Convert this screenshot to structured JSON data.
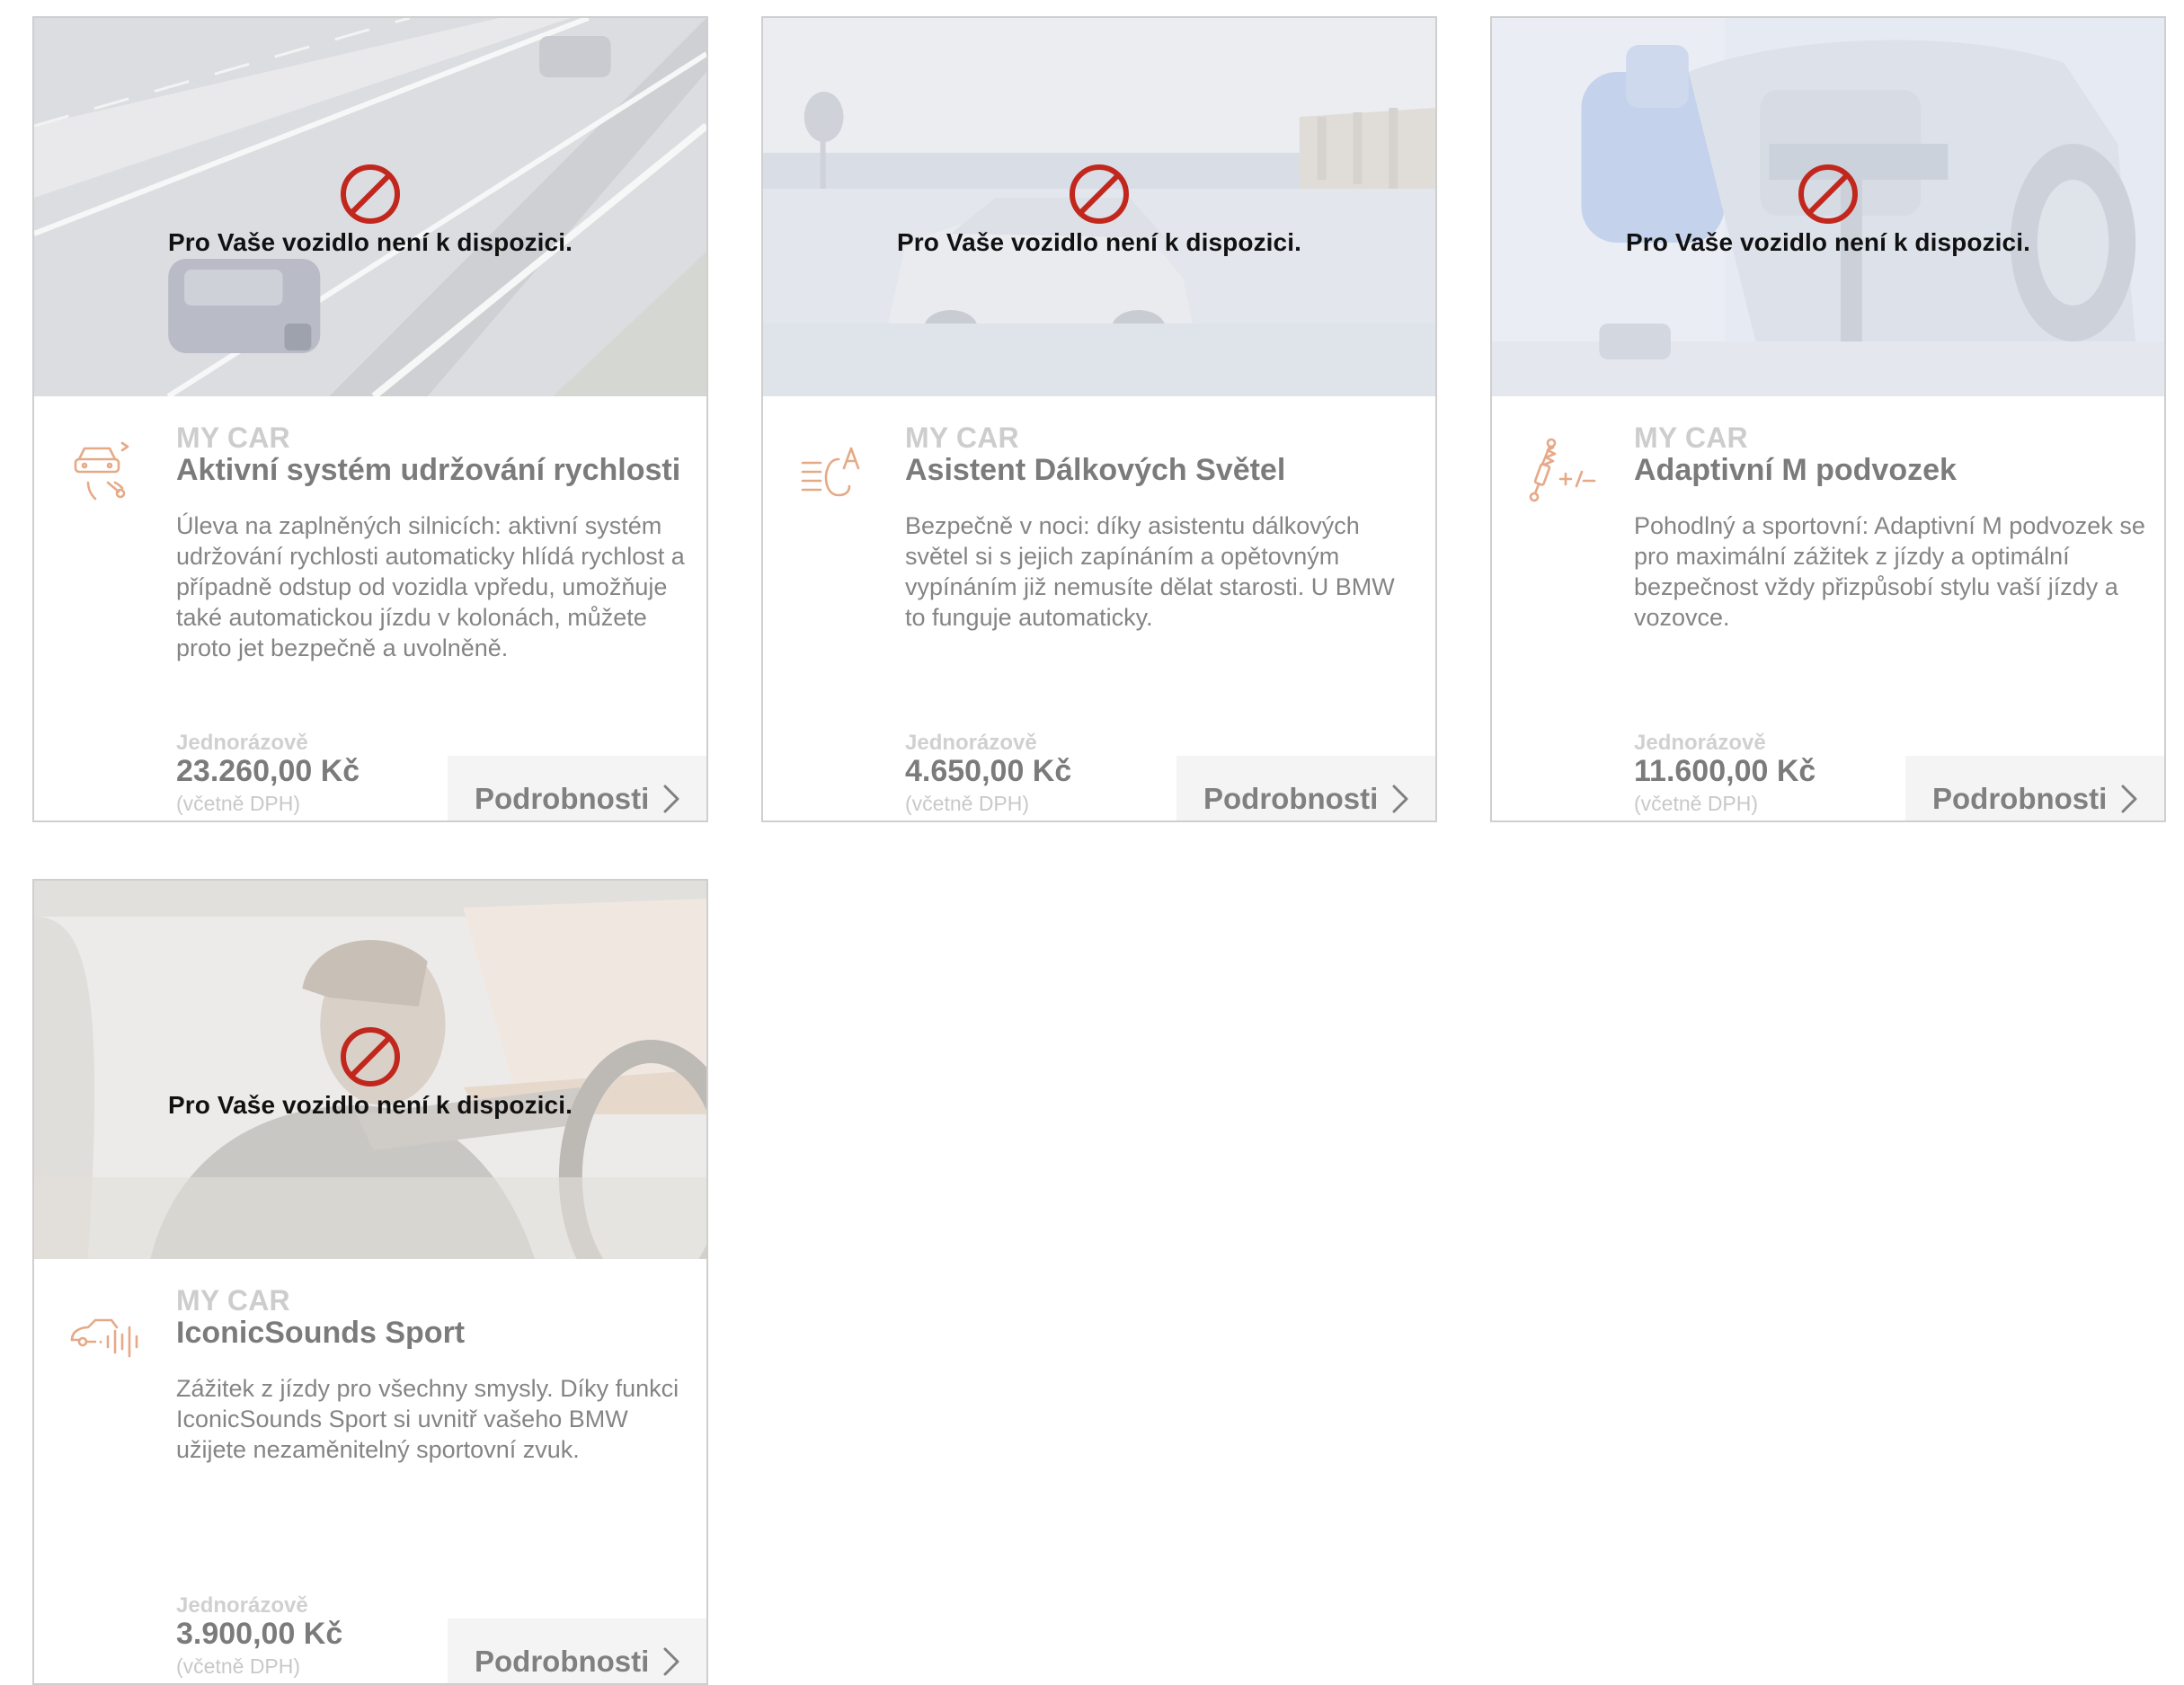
{
  "unavailable_text": "Pro Vaše vozidlo není k dispozici.",
  "accent_color": "#d7763e",
  "unavailable_color": "#c1271d",
  "cards": [
    {
      "icon": "speed-control-car-icon",
      "category": "MY CAR",
      "title": "Aktivní systém udržování rychlosti",
      "description": "Úleva na zaplněných silnicích: aktivní systém udržování rychlosti automaticky hlídá rychlost a případně odstup od vozidla vpředu, umožňuje také automatickou jízdu v kolonách, můžete proto jet bezpečně a uvolněně.",
      "price_label": "Jednorázově",
      "price": "23.260,00 Kč",
      "vat_note": "(včetně DPH)",
      "button_label": "Podrobnosti"
    },
    {
      "icon": "high-beam-assist-icon",
      "category": "MY CAR",
      "title": "Asistent Dálkových Světel",
      "description": "Bezpečně v noci: díky asistentu dálkových světel si s jejich zapínáním a opětovným vypínáním již nemusíte dělat starosti. U BMW to funguje automaticky.",
      "price_label": "Jednorázově",
      "price": "4.650,00 Kč",
      "vat_note": "(včetně DPH)",
      "button_label": "Podrobnosti"
    },
    {
      "icon": "adaptive-suspension-icon",
      "category": "MY CAR",
      "title": "Adaptivní M podvozek",
      "description": "Pohodlný a sportovní: Adaptivní M podvozek se pro maximální zážitek z jízdy a optimální bezpečnost vždy přizpůsobí stylu vaší jízdy a vozovce.",
      "price_label": "Jednorázově",
      "price": "11.600,00 Kč",
      "vat_note": "(včetně DPH)",
      "button_label": "Podrobnosti"
    },
    {
      "icon": "iconic-sounds-icon",
      "category": "MY CAR",
      "title": "IconicSounds Sport",
      "description": "Zážitek z jízdy pro všechny smysly. Díky funkci IconicSounds Sport si uvnitř vašeho BMW užijete nezaměnitelný sportovní zvuk.",
      "price_label": "Jednorázově",
      "price": "3.900,00 Kč",
      "vat_note": "(včetně DPH)",
      "button_label": "Podrobnosti"
    }
  ]
}
